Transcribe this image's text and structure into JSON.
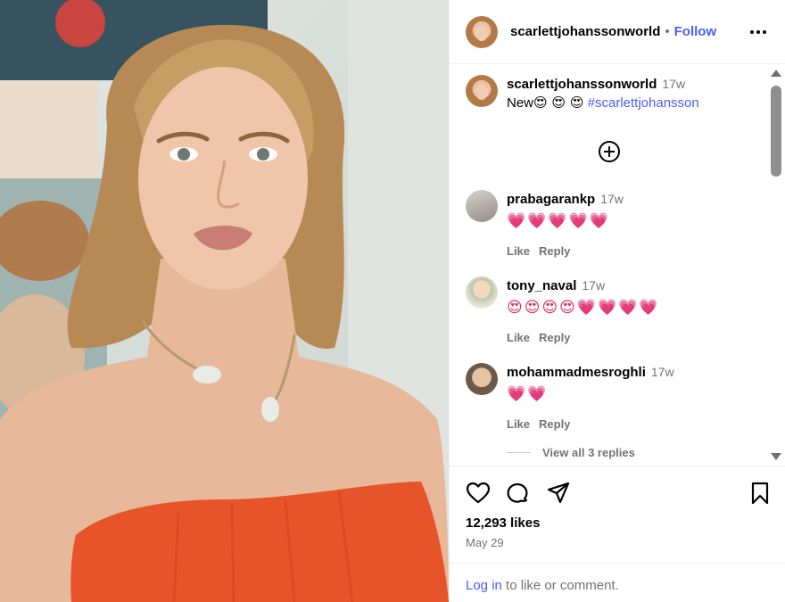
{
  "header": {
    "username": "scarlettjohanssonworld",
    "separator": "•",
    "follow_label": "Follow",
    "more_icon": "more-horizontal-icon"
  },
  "caption": {
    "username": "scarlettjohanssonworld",
    "time": "17w",
    "text": "New",
    "emojis": "😍 😍 😍",
    "hashtag": "#scarlettjohansson"
  },
  "load_more_icon": "plus-circle-icon",
  "comments": [
    {
      "username": "prabagarankp",
      "time": "17w",
      "text": "💗💗💗💗💗",
      "like_label": "Like",
      "reply_label": "Reply"
    },
    {
      "username": "tony_naval",
      "time": "17w",
      "text": "😍😍😍😍💗💗💗💗",
      "like_label": "Like",
      "reply_label": "Reply"
    },
    {
      "username": "mohammadmesroghli",
      "time": "17w",
      "text": "💗💗",
      "like_label": "Like",
      "reply_label": "Reply"
    }
  ],
  "view_replies_label": "View all 3 replies",
  "footer": {
    "likes": "12,293 likes",
    "date": "May 29",
    "login_link": "Log in",
    "login_rest": " to like or comment."
  },
  "colors": {
    "link": "#4a5df9",
    "muted": "#737373",
    "heart": "#e8245b",
    "dress": "#e8542a"
  }
}
